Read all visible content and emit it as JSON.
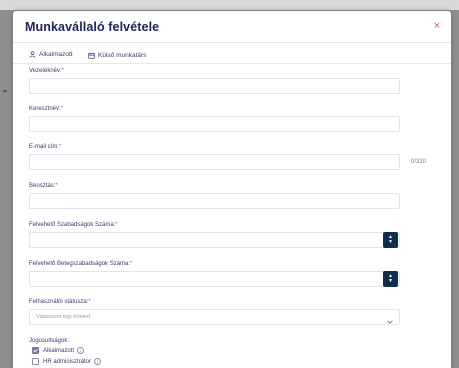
{
  "modal": {
    "title": "Munkavállaló felvétele",
    "close": "×"
  },
  "tabs": [
    {
      "label": "Alkalmazott",
      "icon": "user-icon"
    },
    {
      "label": "Külső munkatárs",
      "icon": "calendar-icon"
    }
  ],
  "form": {
    "lastname_label": "Vezetéknév:",
    "firstname_label": "Keresztnév:",
    "email_label": "E-mail cím:",
    "email_counter": "0/320",
    "position_label": "Beosztás:",
    "leave_days_label": "Felvehető Szabadságok Száma:",
    "sick_days_label": "Felvehető Betegszabadságok Száma:",
    "account_status_label": "Felhasználói státusza:",
    "account_status_placeholder": "Válasszon egy értéket",
    "required_mark": "*"
  },
  "permissions": {
    "title": "Jogosultságok:",
    "items": [
      {
        "label": "Alkalmazott",
        "checked": true
      },
      {
        "label": "HR adminisztrátor",
        "checked": false
      }
    ]
  },
  "colors": {
    "accent": "#0f2e4f",
    "title": "#1f2260",
    "required": "#e05a4c",
    "backdrop": "#8e8e8e"
  }
}
